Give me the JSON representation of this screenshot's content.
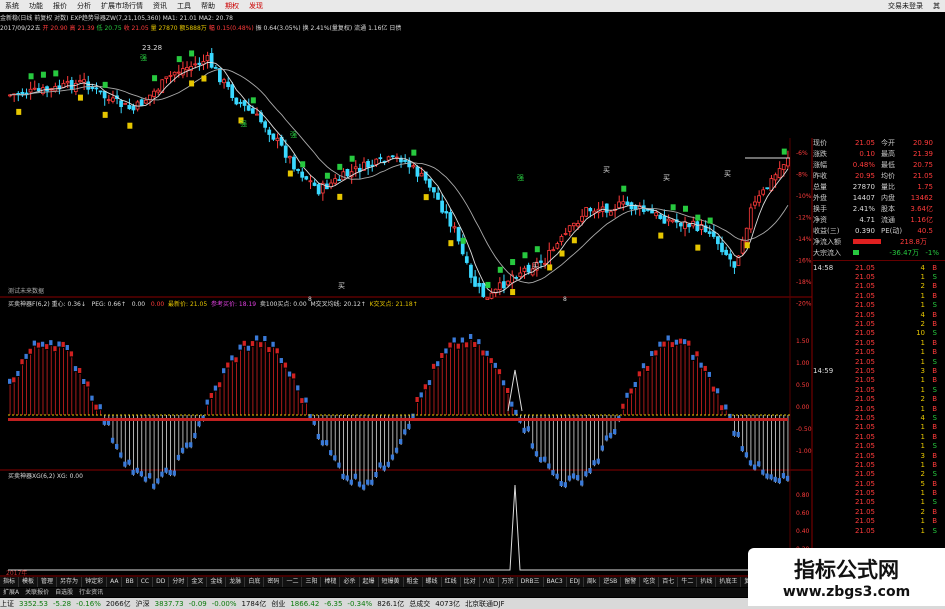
{
  "menubar": {
    "items": [
      "系统",
      "功能",
      "报价",
      "分析",
      "扩展市场行情",
      "资讯",
      "工具",
      "帮助"
    ],
    "trade_items": [
      "期权",
      "发现"
    ],
    "right_items": [
      "交易未登录",
      "其"
    ]
  },
  "info": {
    "line1": "金新稳(日线 前复权 对数) EXP趋势导器ZW(7,21,105,360)  MA1: 21.01  MA2: 20.78",
    "line2_date": "2017/09/22五",
    "line2_open": "开 20.90",
    "line2_high": "高 21.39",
    "line2_low": "低 20.75",
    "line2_close": "收 21.05",
    "line2_vol": "量 27870",
    "line2_amt": "额5888万",
    "line2_chg": "幅 0.15(0.48%)",
    "line2_amp": "振 0.64(3.05%)",
    "line2_turn": "换 2.41%(量复权)",
    "line2_float": "流通 1.16亿",
    "line2_tail": "日债"
  },
  "price_chart": {
    "peak_label": "23.28",
    "signal_labels": [
      "强",
      "强",
      "强",
      "强"
    ],
    "buy_labels": [
      "买",
      "买",
      "买",
      "买",
      "买"
    ],
    "right_axis": [
      "-6%",
      "-8%",
      "-10%",
      "-12%",
      "-14%",
      "-16%",
      "-18%",
      "-20%"
    ],
    "bottom_note": "测试未来数据",
    "month_marks": [
      "8",
      "8"
    ]
  },
  "indicator1": {
    "header": "买卖神器F(6,2)  重心: 0.36↓",
    "peg": "PEG: 0.66↑",
    "v1": "0.00",
    "v2": "0.00",
    "newprice": "最新价: 21.05",
    "buy_label": "参考买价: 18.19",
    "line3": "卖100买点: 0.00",
    "line4": "M交叉均线: 20.12↑",
    "line5": "K交叉点: 21.18↑",
    "axis": [
      "1.50",
      "1.00",
      "0.50",
      "0.00",
      "-0.50",
      "-1.00"
    ]
  },
  "indicator2": {
    "header": "买卖神器XG(6,2)  XG: 0.00",
    "axis": [
      "0.80",
      "0.60",
      "0.40",
      "0.20"
    ]
  },
  "quote": {
    "rows": [
      {
        "l": "现价",
        "v": "21.05",
        "l2": "今开",
        "v2": "20.90"
      },
      {
        "l": "涨跌",
        "v": "0.10",
        "l2": "最高",
        "v2": "21.39"
      },
      {
        "l": "涨幅",
        "v": "0.48%",
        "l2": "最低",
        "v2": "20.75"
      },
      {
        "l": "昨收",
        "v": "20.95",
        "l2": "均价",
        "v2": "21.05"
      },
      {
        "l": "总量",
        "v": "27870",
        "l2": "量比",
        "v2": "1.75"
      },
      {
        "l": "外盘",
        "v": "14407",
        "l2": "内盘",
        "v2": "13462"
      },
      {
        "l": "换手",
        "v": "2.41%",
        "l2": "股本",
        "v2": "3.64亿"
      },
      {
        "l": "净资",
        "v": "4.71",
        "l2": "流通",
        "v2": "1.16亿"
      },
      {
        "l": "收益(三)",
        "v": "0.390",
        "l2": "PE(动)",
        "v2": "40.5"
      }
    ],
    "netflow_label": "净流入额",
    "netflow_value": "218.8万",
    "bigflow_label": "大宗流入",
    "bigflow_value": "-36.47万",
    "bigflow_pct": "-1%",
    "time1": "14:58",
    "time2": "14:59",
    "trade_price": "21.05",
    "trades_count": 29
  },
  "tabs": [
    "指标",
    "模板",
    "管理",
    "另存为",
    "钟定彩",
    "AA",
    "BB",
    "CC",
    "DD",
    "分时",
    "金叉",
    "金线",
    "龙脉",
    "白底",
    "密码",
    "一二",
    "三阳",
    "棒槌",
    "必杀",
    "起爆",
    "短爆黄",
    "粗金",
    "螺线",
    "红线",
    "比对",
    "八位",
    "万宗",
    "DRB三",
    "BAC3",
    "EDJ",
    "周k",
    "逆SB",
    "留警",
    "吃货",
    "百七",
    "牛二",
    "扒线",
    "扒底王",
    "复盘",
    "侵复"
  ],
  "subtabs": [
    "扩展A",
    "关联报价",
    "自选股",
    "行业资讯"
  ],
  "status": {
    "s1_label": "上证",
    "s1_val": "3352.53",
    "s1_chg": "-5.28",
    "s1_pct": "-0.16%",
    "s1_amt": "2066亿",
    "s2_label": "沪深",
    "s2_val": "3837.73",
    "s2_chg": "-0.09",
    "s2_pct": "-0.00%",
    "s2_amt": "1784亿",
    "s3_label": "创业",
    "s3_val": "1866.42",
    "s3_chg": "-6.35",
    "s3_pct": "-0.34%",
    "s3_amt": "826.1亿",
    "s4_label": "总成交",
    "s4_val": "4073亿",
    "s5": "北京联通DJF"
  },
  "watermark": {
    "title": "指标公式网",
    "url": "www.zbgs3.com"
  },
  "year_label": "2017年",
  "colors": {
    "up": "#ff3b3b",
    "down": "#3ad8ff",
    "ma": "#dddddd",
    "background": "#000000"
  }
}
